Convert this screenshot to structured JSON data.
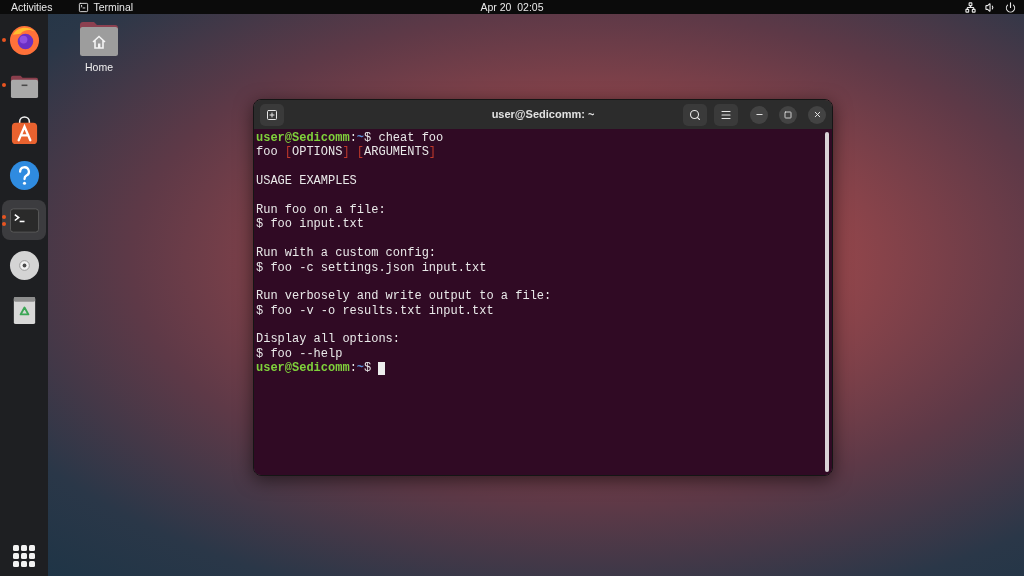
{
  "top_bar": {
    "activities": "Activities",
    "app_menu": {
      "label": "Terminal"
    },
    "clock": "Apr 20  02:05"
  },
  "dock": {
    "items": [
      {
        "kind": "browser",
        "running": true,
        "multiple_windows": false,
        "selected": false
      },
      {
        "kind": "files",
        "running": true,
        "multiple_windows": false,
        "selected": false
      },
      {
        "kind": "store",
        "running": false,
        "multiple_windows": false,
        "selected": false
      },
      {
        "kind": "help",
        "running": false,
        "multiple_windows": false,
        "selected": false
      },
      {
        "kind": "terminal",
        "running": true,
        "multiple_windows": true,
        "selected": true
      },
      {
        "kind": "disc",
        "running": false,
        "multiple_windows": false,
        "selected": false
      },
      {
        "kind": "trash",
        "running": false,
        "multiple_windows": false,
        "selected": false
      }
    ]
  },
  "desktop": {
    "icons": [
      {
        "label": "Home"
      }
    ]
  },
  "terminal": {
    "title": "user@Sedicomm: ~",
    "lines": [
      {
        "kind": "prompt",
        "user_host": "user@Sedicomm",
        "separator": ":",
        "path": "~",
        "symbol": "$",
        "command": "cheat foo",
        "cursor": false
      },
      {
        "kind": "segments",
        "segments": [
          {
            "text": "foo ",
            "kind": "plain"
          },
          {
            "text": "[",
            "kind": "bracket"
          },
          {
            "text": "OPTIONS",
            "kind": "plain"
          },
          {
            "text": "] [",
            "kind": "bracket"
          },
          {
            "text": "ARGUMENTS",
            "kind": "plain"
          },
          {
            "text": "]",
            "kind": "bracket"
          }
        ]
      },
      {
        "kind": "blank"
      },
      {
        "kind": "text",
        "text": "USAGE EXAMPLES"
      },
      {
        "kind": "blank"
      },
      {
        "kind": "text",
        "text": "Run foo on a file:"
      },
      {
        "kind": "text",
        "text": "$ foo input.txt"
      },
      {
        "kind": "blank"
      },
      {
        "kind": "text",
        "text": "Run with a custom config:"
      },
      {
        "kind": "text",
        "text": "$ foo -c settings.json input.txt"
      },
      {
        "kind": "blank"
      },
      {
        "kind": "text",
        "text": "Run verbosely and write output to a file:"
      },
      {
        "kind": "text",
        "text": "$ foo -v -o results.txt input.txt"
      },
      {
        "kind": "blank"
      },
      {
        "kind": "text",
        "text": "Display all options:"
      },
      {
        "kind": "text",
        "text": "$ foo --help"
      },
      {
        "kind": "prompt",
        "user_host": "user@Sedicomm",
        "separator": ":",
        "path": "~",
        "symbol": "$",
        "cursor": true
      }
    ]
  }
}
